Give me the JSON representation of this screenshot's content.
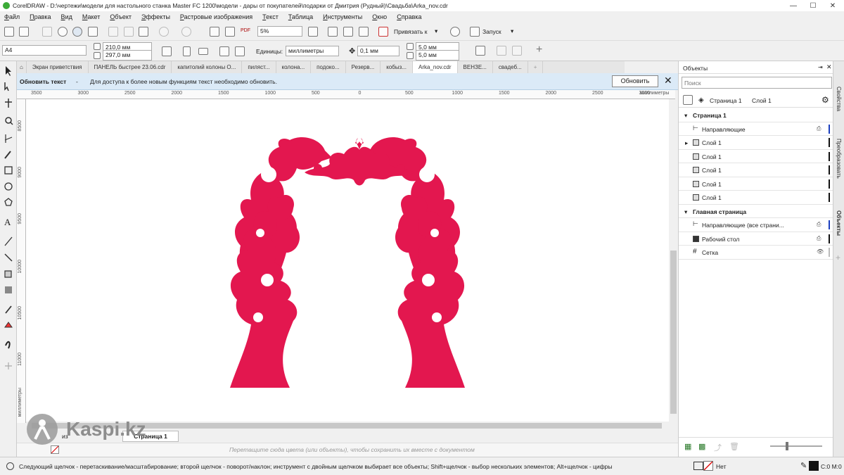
{
  "window": {
    "title": "CorelDRAW - D:\\чертежи\\модели для настольного станка Master FC 1200\\модели - дары от покупателей\\подарки от Дмитрия (Рудный)\\Свадьба\\Arka_nov.cdr",
    "minimize": "—",
    "maximize": "☐",
    "close": "✕"
  },
  "menu": [
    "Файл",
    "Правка",
    "Вид",
    "Макет",
    "Объект",
    "Эффекты",
    "Растровые изображения",
    "Текст",
    "Таблица",
    "Инструменты",
    "Окно",
    "Справка"
  ],
  "toolbar1": {
    "zoom": "5%",
    "snap_label": "Привязать к",
    "launch_label": "Запуск"
  },
  "toolbar2": {
    "page_size": "A4",
    "width": "210,0 мм",
    "height": "297,0 мм",
    "units_label": "Единицы:",
    "units_value": "миллиметры",
    "nudge": "0,1 мм",
    "dup_x": "5,0 мм",
    "dup_y": "5,0 мм"
  },
  "tabs": [
    "Экран приветствия",
    "ПАНЕЛЬ быстрее 23.06.cdr",
    "капитолий колоны О...",
    "пиляст...",
    "колона...",
    "подоко...",
    "Резерв...",
    "кобыз...",
    "Arka_nov.cdr",
    "ВЕНЗЕ...",
    "свадеб..."
  ],
  "active_tab": 8,
  "infobar": {
    "title": "Обновить текст",
    "dash": "-",
    "message": "Для доступа к более новым функциям текст необходимо обновить.",
    "button": "Обновить"
  },
  "hruler_ticks": [
    "3500",
    "3000",
    "2500",
    "2000",
    "1500",
    "1000",
    "500",
    "0",
    "500",
    "1000",
    "1500",
    "2000",
    "2500",
    "3000"
  ],
  "hruler_unit": "миллиметры",
  "vruler_ticks": [
    "8500",
    "9000",
    "9500",
    "10000",
    "10500",
    "11000"
  ],
  "vruler_unit": "миллиметры",
  "artwork_color": "#e3174f",
  "pagebar": {
    "of_label": "из",
    "page_tab": "Страница 1"
  },
  "palette_hint": "Перетащите сюда цвета (или объекты), чтобы сохранить их вместе с документом",
  "status": {
    "hint": "Следующий щелчок - перетаскивание/масштабирование; второй щелчок - поворот/наклон; инструмент с двойным щелчком выбирает все объекты; Shift+щелчок - выбор нескольких элементов; Alt+щелчок - цифры",
    "fill": "Нет",
    "color": "C:0 M:0"
  },
  "panel": {
    "title": "Объекты",
    "search_placeholder": "Поиск",
    "page_label": "Страница 1",
    "layer_label": "Слой 1",
    "tree": [
      {
        "text": "Страница 1",
        "kind": "header"
      },
      {
        "text": "Направляющие",
        "kind": "guides",
        "bar": "#1b3fbf"
      },
      {
        "text": "Слой 1",
        "kind": "layer",
        "expand": true,
        "bar": "#111"
      },
      {
        "text": "Слой 1",
        "kind": "layer",
        "bar": "#111"
      },
      {
        "text": "Слой 1",
        "kind": "layer",
        "bar": "#111"
      },
      {
        "text": "Слой 1",
        "kind": "layer",
        "bar": "#111"
      },
      {
        "text": "Слой 1",
        "kind": "layer",
        "bar": "#111"
      },
      {
        "text": "Главная страница",
        "kind": "header"
      },
      {
        "text": "Направляющие (все страни...",
        "kind": "guides",
        "bar": "#1b3fbf"
      },
      {
        "text": "Рабочий стол",
        "kind": "desktop",
        "bar": "#111"
      },
      {
        "text": "Сетка",
        "kind": "grid",
        "bar": "#bbb"
      }
    ]
  },
  "dock_tabs": [
    "Свойства",
    "Преобразовать",
    "Объекты"
  ],
  "watermark": "Kaspi.kz"
}
